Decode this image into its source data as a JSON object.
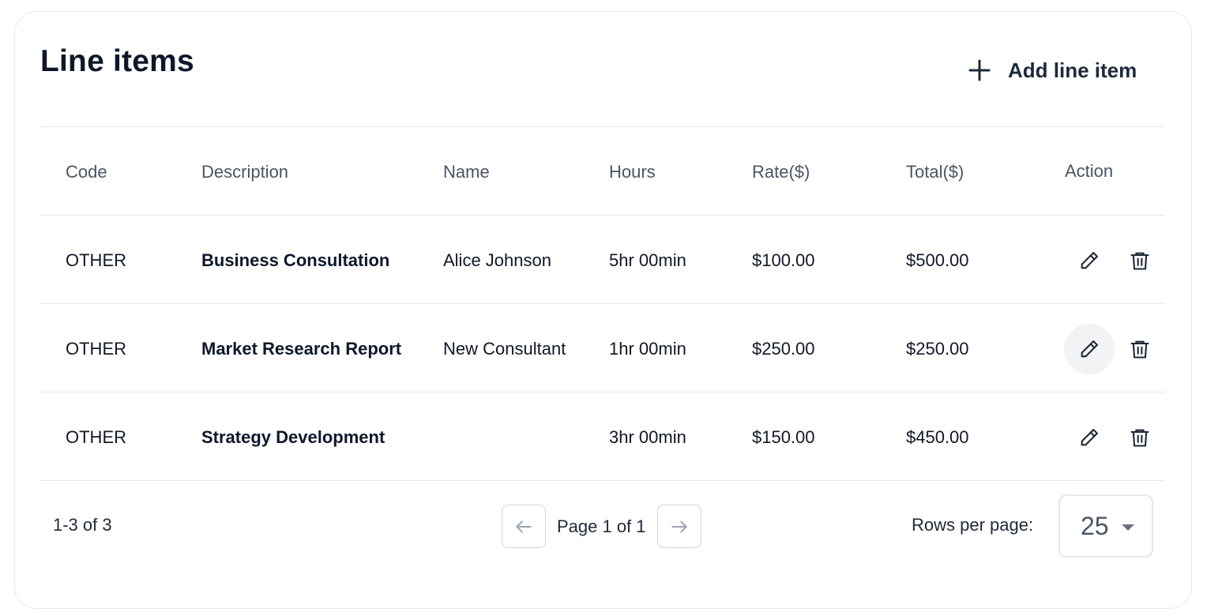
{
  "title": "Line items",
  "add_button_label": "Add line item",
  "columns": {
    "code": "Code",
    "description": "Description",
    "name": "Name",
    "hours": "Hours",
    "rate": "Rate($)",
    "total": "Total($)",
    "action": "Action"
  },
  "rows": [
    {
      "code": "OTHER",
      "description": "Business Consultation",
      "name": "Alice Johnson",
      "hours": "5hr 00min",
      "rate": "$100.00",
      "total": "$500.00"
    },
    {
      "code": "OTHER",
      "description": "Market Research Report",
      "name": "New Consultant",
      "hours": "1hr 00min",
      "rate": "$250.00",
      "total": "$250.00"
    },
    {
      "code": "OTHER",
      "description": "Strategy Development",
      "name": "",
      "hours": "3hr 00min",
      "rate": "$150.00",
      "total": "$450.00"
    }
  ],
  "footer": {
    "range_text": "1-3 of 3",
    "page_text": "Page 1 of 1",
    "rows_per_page_label": "Rows per page:",
    "rows_per_page_value": "25"
  },
  "colors": {
    "title": "#0f172a",
    "border": "#e5e7eb",
    "hover_bg": "#f1f3f5"
  },
  "icons": [
    "plus-icon",
    "pencil-icon",
    "trash-icon",
    "arrow-left-icon",
    "arrow-right-icon",
    "caret-down-icon"
  ]
}
